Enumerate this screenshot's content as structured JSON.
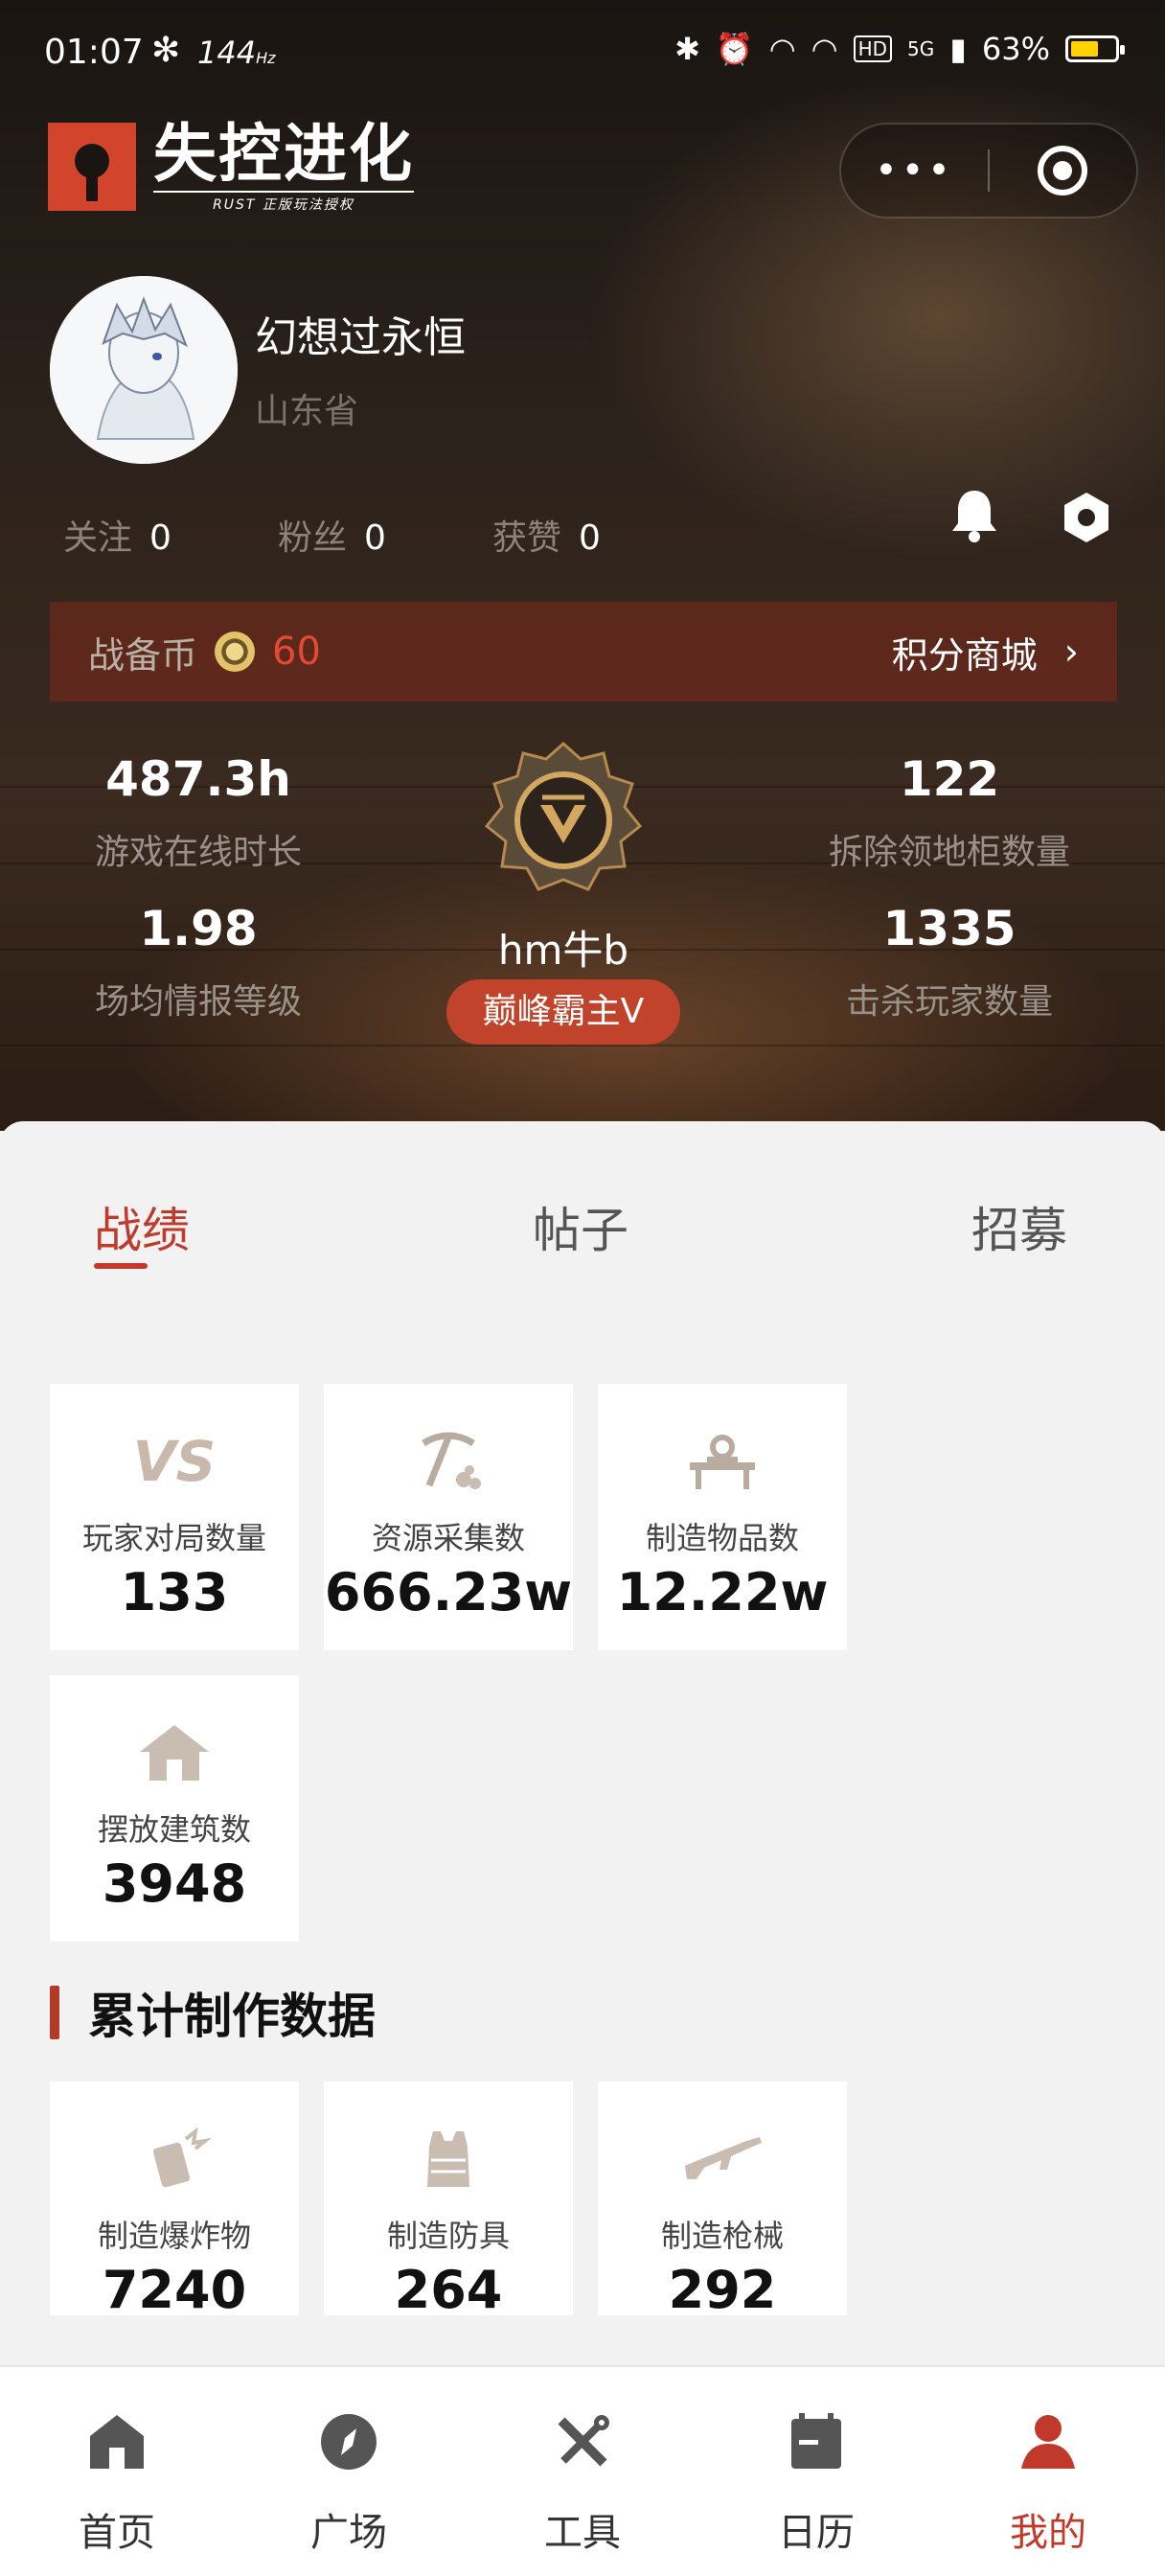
{
  "status_bar": {
    "time": "01:07",
    "refresh": "144",
    "hz": "Hz",
    "network": "5G",
    "battery": "63%",
    "battery_level": 0.63
  },
  "app": {
    "logo_title": "失控进化",
    "logo_subtitle": "RUST 正版玩法授权"
  },
  "profile": {
    "username": "幻想过永恒",
    "province": "山东省",
    "follow": {
      "label": "关注",
      "value": "0"
    },
    "fans": {
      "label": "粉丝",
      "value": "0"
    },
    "likes": {
      "label": "获赞",
      "value": "0"
    }
  },
  "coin_bar": {
    "label": "战备币",
    "value": "60",
    "mall_label": "积分商城"
  },
  "stats": {
    "online_hours": {
      "value": "487.3h",
      "label": "游戏在线时长"
    },
    "intel_level": {
      "value": "1.98",
      "label": "场均情报等级"
    },
    "cabinets": {
      "value": "122",
      "label": "拆除领地柜数量"
    },
    "kills": {
      "value": "1335",
      "label": "击杀玩家数量"
    }
  },
  "rank": {
    "name": "hm牛b",
    "title": "巅峰霸主V"
  },
  "tabs": [
    "战绩",
    "帖子",
    "招募"
  ],
  "record_cards": [
    {
      "icon": "vs-icon",
      "vs_text": "VS",
      "label": "玩家对局数量",
      "value": "133"
    },
    {
      "icon": "pickaxe-icon",
      "label": "资源采集数",
      "value": "666.23w"
    },
    {
      "icon": "workbench-icon",
      "label": "制造物品数",
      "value": "12.22w"
    },
    {
      "icon": "house-icon",
      "label": "摆放建筑数",
      "value": "3948"
    }
  ],
  "craft_section": {
    "title": "累计制作数据"
  },
  "craft_cards": [
    {
      "icon": "explosive-icon",
      "label": "制造爆炸物",
      "value": "7240"
    },
    {
      "icon": "armor-vest-icon",
      "label": "制造防具",
      "value": "264"
    },
    {
      "icon": "rifle-icon",
      "label": "制造枪械",
      "value": "292"
    }
  ],
  "nav": [
    {
      "icon": "home-icon",
      "label": "首页"
    },
    {
      "icon": "compass-icon",
      "label": "广场"
    },
    {
      "icon": "tools-icon",
      "label": "工具"
    },
    {
      "icon": "calendar-icon",
      "label": "日历"
    },
    {
      "icon": "user-icon",
      "label": "我的",
      "active": true
    }
  ],
  "colors": {
    "accent": "#c0392b",
    "coin_bar": "#782a1c",
    "pill": "#c2432b"
  }
}
